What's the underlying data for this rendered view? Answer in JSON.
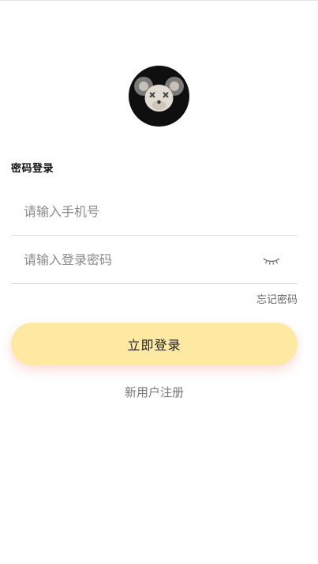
{
  "avatar": {
    "icon": "bear-avatar-icon"
  },
  "section_title": "密码登录",
  "phone_field": {
    "placeholder": "请输入手机号",
    "value": ""
  },
  "password_field": {
    "placeholder": "请输入登录密码",
    "value": "",
    "toggle_icon": "eye-closed-icon"
  },
  "forgot_link": "忘记密码",
  "login_button": "立即登录",
  "register_link": "新用户注册",
  "colors": {
    "button_bg": "#fde9a2",
    "button_shadow": "#f4b2aa",
    "divider": "#dcdcdc",
    "placeholder": "#8a8a8a"
  }
}
